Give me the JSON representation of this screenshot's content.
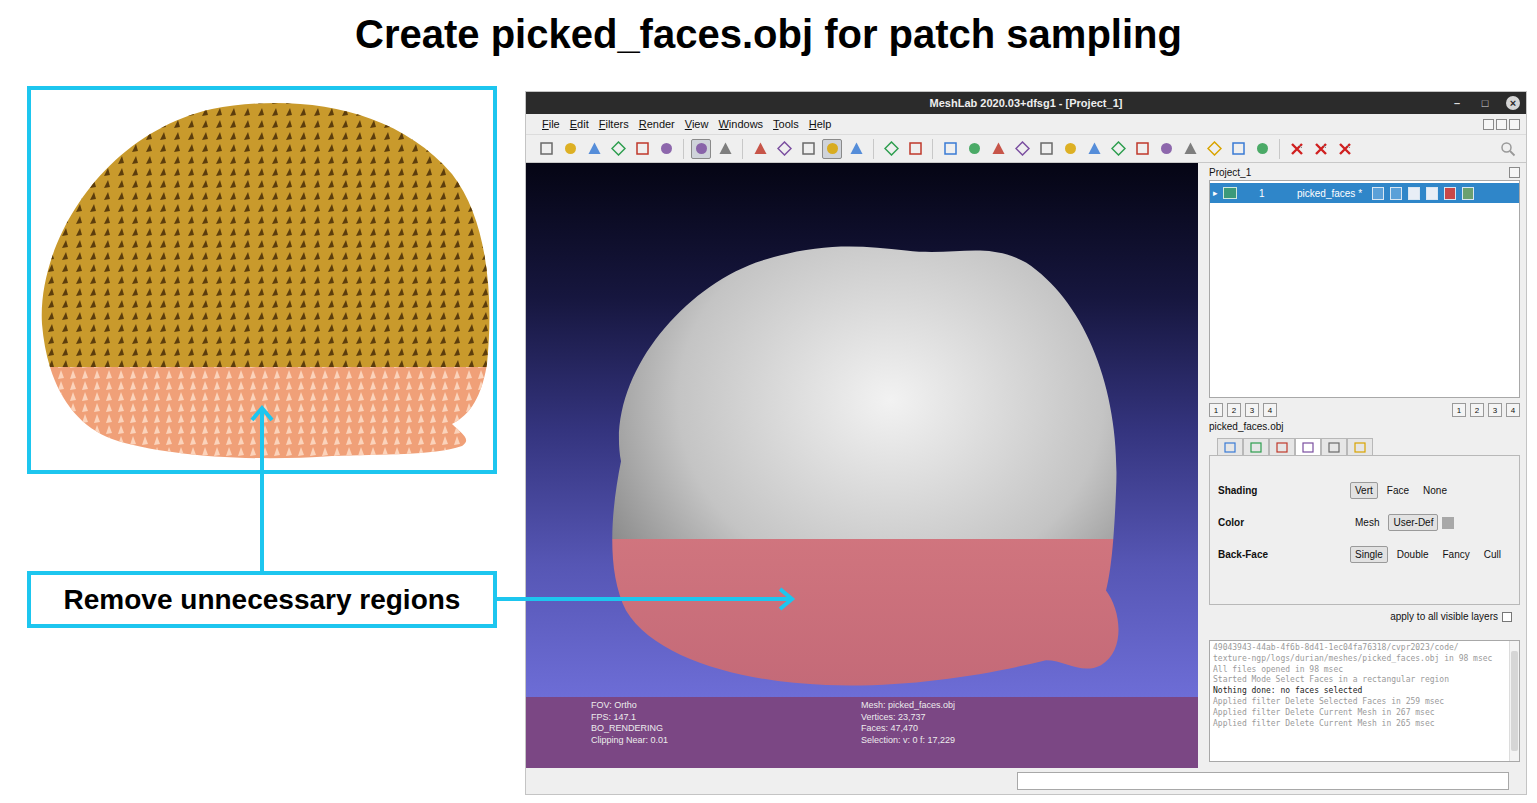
{
  "figure": {
    "title": "Create picked_faces.obj for patch sampling",
    "callout": "Remove unnecessary regions"
  },
  "window": {
    "title": "MeshLab 2020.03+dfsg1 - [Project_1]",
    "controls": [
      "–",
      "□",
      "×"
    ]
  },
  "menu": [
    "File",
    "Edit",
    "Filters",
    "Render",
    "View",
    "Windows",
    "Tools",
    "Help"
  ],
  "toolbar": [
    {
      "kind": "tool",
      "buttons": [
        {
          "selected": false
        },
        {
          "selected": false
        },
        {
          "selected": false
        },
        {
          "selected": false
        },
        {
          "selected": false
        },
        {
          "selected": false
        }
      ]
    },
    {
      "kind": "tool",
      "buttons": [
        {
          "selected": true
        },
        {
          "selected": false
        }
      ]
    },
    {
      "kind": "tool",
      "buttons": [
        {
          "selected": false
        },
        {
          "selected": false
        },
        {
          "selected": false
        },
        {
          "selected": true
        },
        {
          "selected": false
        }
      ]
    },
    {
      "kind": "tool",
      "buttons": [
        {
          "selected": false
        },
        {
          "selected": false
        }
      ]
    },
    {
      "kind": "tool",
      "buttons": [
        {
          "selected": false
        },
        {
          "selected": false
        },
        {
          "selected": false
        },
        {
          "selected": false
        },
        {
          "selected": false
        },
        {
          "selected": false
        },
        {
          "selected": false
        },
        {
          "selected": false
        },
        {
          "selected": false
        },
        {
          "selected": false
        },
        {
          "selected": false
        },
        {
          "selected": false
        },
        {
          "selected": false
        },
        {
          "selected": false
        }
      ]
    },
    {
      "kind": "delete",
      "buttons": [
        {
          "selected": false
        },
        {
          "selected": false
        },
        {
          "selected": false
        }
      ]
    }
  ],
  "viewport_info": {
    "render": [
      "FOV: Ortho",
      "FPS: 147.1",
      "BO_RENDERING",
      "Clipping Near:  0.01"
    ],
    "mesh": [
      "Mesh: picked_faces.obj",
      "Vertices: 23,737",
      "Faces: 47,470",
      "Selection: v: 0 f: 17,229"
    ]
  },
  "project": {
    "title": "Project_1",
    "layers": [
      {
        "expander": "▸",
        "number": "1",
        "name": "picked_faces *",
        "selected": true
      }
    ]
  },
  "view_buttons": {
    "left": [
      "1",
      "2",
      "3",
      "4"
    ],
    "right": [
      "1",
      "2",
      "3",
      "4"
    ]
  },
  "layer_label": "picked_faces.obj",
  "tabs": [
    {
      "selected": false
    },
    {
      "selected": false
    },
    {
      "selected": false
    },
    {
      "selected": true
    },
    {
      "selected": false
    },
    {
      "selected": false
    }
  ],
  "render_options": [
    {
      "label": "Shading",
      "swatch": false,
      "options": [
        {
          "label": "Vert",
          "selected": true
        },
        {
          "label": "Face",
          "selected": false
        },
        {
          "label": "None",
          "selected": false
        }
      ]
    },
    {
      "label": "Color",
      "swatch": true,
      "options": [
        {
          "label": "Mesh",
          "selected": false
        },
        {
          "label": "User-Def",
          "selected": true
        }
      ]
    },
    {
      "label": "Back-Face",
      "swatch": false,
      "options": [
        {
          "label": "Single",
          "selected": true
        },
        {
          "label": "Double",
          "selected": false
        },
        {
          "label": "Fancy",
          "selected": false
        },
        {
          "label": "Cull",
          "selected": false
        }
      ]
    }
  ],
  "apply_all": {
    "label": "apply to all visible layers",
    "checked": false
  },
  "log": [
    {
      "text": "49043943-44ab-4f6b-8d41-1ec04fa76318/cvpr2023/code/",
      "emphasis": false
    },
    {
      "text": "texture-ngp/logs/durian/meshes/picked_faces.obj in 98 msec",
      "emphasis": false
    },
    {
      "text": "All files opened in 98 msec",
      "emphasis": false
    },
    {
      "text": "Started Mode Select Faces in a rectangular region",
      "emphasis": false
    },
    {
      "text": "Nothing done: no faces selected",
      "emphasis": true
    },
    {
      "text": "Applied filter Delete Selected Faces in 259 msec",
      "emphasis": false
    },
    {
      "text": "Applied filter Delete Current Mesh in 267 msec",
      "emphasis": false
    },
    {
      "text": "Applied filter Delete Current Mesh in 265 msec",
      "emphasis": false
    }
  ],
  "status_bar": {
    "field": ""
  }
}
